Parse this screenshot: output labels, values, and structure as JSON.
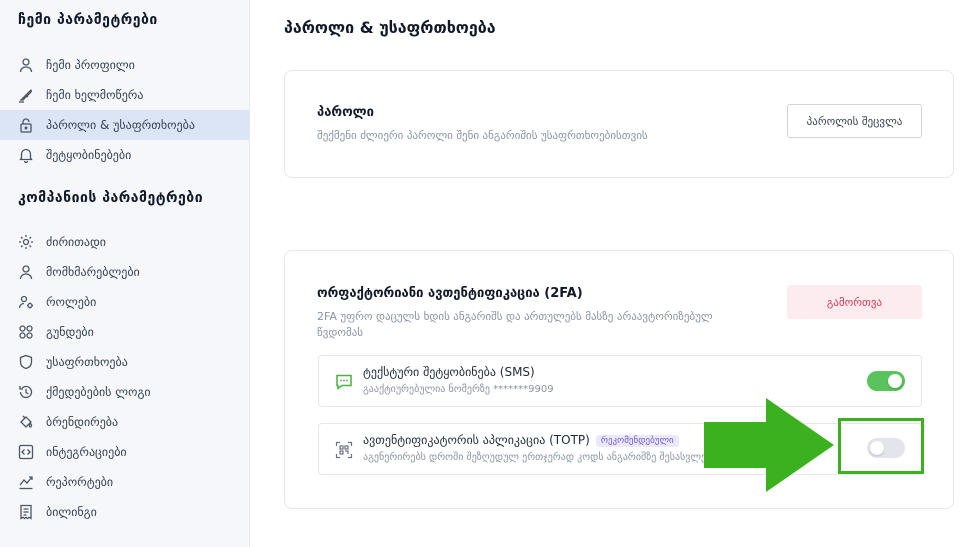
{
  "sidebar": {
    "my_settings_title": "ჩემი პარამეტრები",
    "my_items": [
      {
        "label": "ჩემი პროფილი",
        "icon": "user-icon"
      },
      {
        "label": "ჩემი ხელმოწერა",
        "icon": "signature-icon"
      },
      {
        "label": "პაროლი & უსაფრთხოება",
        "icon": "lock-icon",
        "active": true
      },
      {
        "label": "შეტყობინებები",
        "icon": "bell-icon"
      }
    ],
    "company_settings_title": "კომპანიის პარამეტრები",
    "company_items": [
      {
        "label": "ძირითადი",
        "icon": "settings-gear-icon"
      },
      {
        "label": "მომხმარებლები",
        "icon": "user-icon"
      },
      {
        "label": "როლები",
        "icon": "roles-icon"
      },
      {
        "label": "გუნდები",
        "icon": "teams-icon"
      },
      {
        "label": "უსაფრთხოება",
        "icon": "shield-icon"
      },
      {
        "label": "ქმედებების ლოგი",
        "icon": "history-icon"
      },
      {
        "label": "ბრენდირება",
        "icon": "paint-bucket-icon"
      },
      {
        "label": "ინტეგრაციები",
        "icon": "code-icon"
      },
      {
        "label": "რეპორტები",
        "icon": "chart-icon"
      },
      {
        "label": "ბილინგი",
        "icon": "receipt-icon"
      }
    ]
  },
  "main": {
    "title": "პაროლი & უსაფრთხოება",
    "password_card": {
      "title": "პაროლი",
      "description": "შექმენი ძლიერი პაროლი შენი ანგარიშის უსაფრთხოებისთვის",
      "button": "პაროლის შეცვლა"
    },
    "twofa_card": {
      "title": "ორფაქტორიანი ავთენტიფიკაცია (2FA)",
      "description": "2FA უფრო დაცულს ხდის ანგარიშს და ართულებს მასზე არაავტორიზებულ წვდომას",
      "disable_button": "გამორთვა",
      "sms": {
        "title": "ტექსტური შეტყობინება (SMS)",
        "subtitle": "გააქტიურებულია ნომერზე *******9909",
        "enabled": true,
        "icon": "sms-icon"
      },
      "totp": {
        "title": "ავთენტიფიკატორის აპლიკაცია (TOTP)",
        "badge": "რეკომენდებული",
        "subtitle": "აგენერირებს დროში შეზღუდულ ერთჯერად კოდს ანგარიშზე შესასვლელად",
        "enabled": false,
        "icon": "qr-code-icon"
      }
    }
  },
  "colors": {
    "accent_green": "#3cb11f",
    "toggle_on": "#5bc35b",
    "danger": "#d93654",
    "sidebar_active": "#dbe5f5",
    "badge": "#6d5bd0"
  }
}
